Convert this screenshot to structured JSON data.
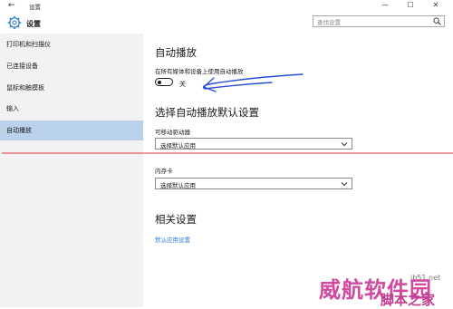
{
  "window": {
    "title": "设置",
    "back_glyph": "←",
    "min_glyph": "—",
    "max_glyph": "☐",
    "close_glyph": "✕"
  },
  "header": {
    "app_name": "设置",
    "search_placeholder": "查找设置"
  },
  "sidebar": {
    "items": [
      {
        "label": "打印机和扫描仪"
      },
      {
        "label": "已连接设备"
      },
      {
        "label": "鼠标和触摸板"
      },
      {
        "label": "输入"
      },
      {
        "label": "自动播放"
      }
    ],
    "active_index": 4
  },
  "main": {
    "title": "自动播放",
    "autoplay_label": "在所有媒体和设备上使用自动播放",
    "toggle": {
      "state_text": "关",
      "on": false
    },
    "defaults_title": "选择自动播放默认设置",
    "removable": {
      "label": "可移动驱动器",
      "value": "选择默认应用"
    },
    "memory_card": {
      "label": "内存卡",
      "value": "选择默认应用"
    },
    "related_title": "相关设置",
    "related_link": "默认应用设置"
  },
  "watermark": {
    "text": "威航软件园",
    "sub": "脚本之家",
    "url": "jb51.net"
  },
  "colors": {
    "accent": "#2d7bd4",
    "active_item": "#b9d1ea",
    "sidebar_bg": "#f2f2f2",
    "annotation": "#d9393e",
    "pen": "#2a4fd6"
  }
}
